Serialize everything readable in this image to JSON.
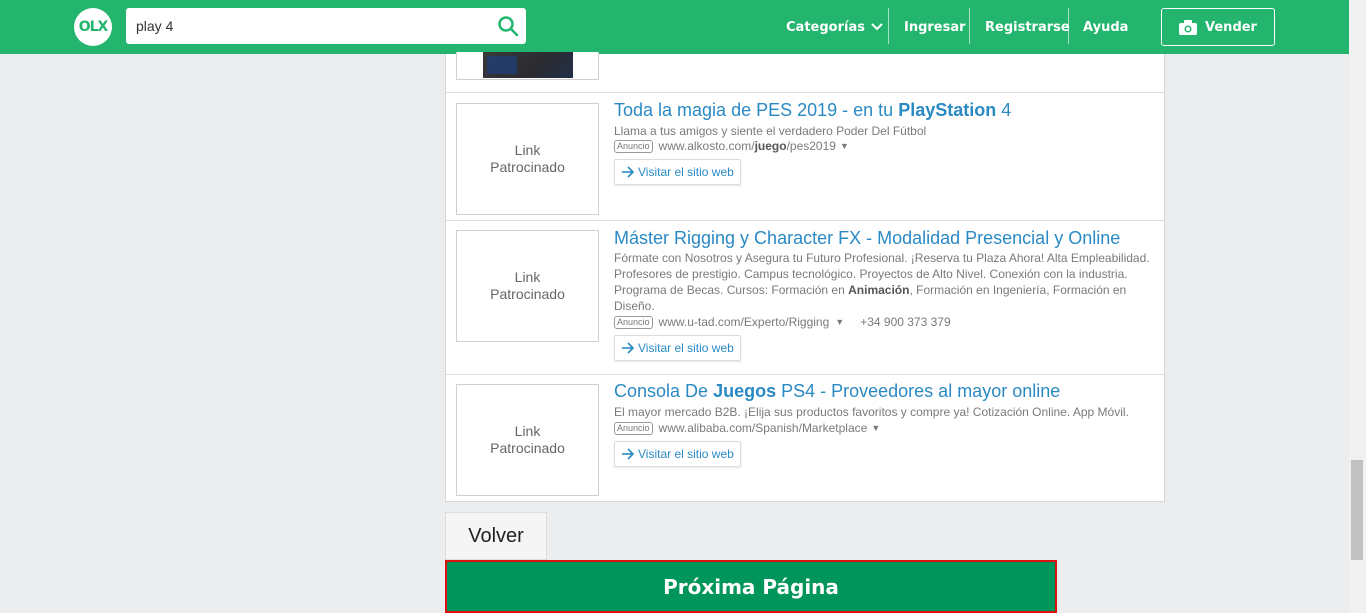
{
  "header": {
    "logo_text": "OLX",
    "search_value": "play 4",
    "nav": {
      "categorias": "Categorías",
      "ingresar": "Ingresar",
      "registrarse": "Registrarse",
      "ayuda": "Ayuda",
      "vender": "Vender"
    }
  },
  "ads": [
    {
      "thumb_label_1": "Link",
      "thumb_label_2": "Patrocinado",
      "title_pre": "Toda la magia de PES 2019 ",
      "title_dash": "- en tu ",
      "title_bold": "PlayStation",
      "title_post": " 4",
      "desc": "Llama a tus amigos y siente el verdadero Poder Del Fútbol",
      "badge": "Anuncio",
      "url_pre": "www.alkosto.com/",
      "url_bold": "juego",
      "url_post": "/pes2019",
      "visit": "Visitar el sitio web"
    },
    {
      "thumb_label_1": "Link",
      "thumb_label_2": "Patrocinado",
      "title_pre": "Máster Rigging y Character FX ",
      "title_dash": "- Modalidad Presencial y Online",
      "desc_pre": "Fórmate con Nosotros y Asegura tu Futuro Profesional. ¡Reserva tu Plaza Ahora! Alta Empleabilidad. Profesores de prestigio. Campus tecnológico. Proyectos de Alto Nivel. Conexión con la industria. Programa de Becas. Cursos: Formación en ",
      "desc_bold": "Animación",
      "desc_post": ", Formación en Ingeniería, Formación en Diseño.",
      "badge": "Anuncio",
      "url": "www.u-tad.com/Experto/Rigging",
      "phone": "+34 900 373 379",
      "visit": "Visitar el sitio web"
    },
    {
      "thumb_label_1": "Link",
      "thumb_label_2": "Patrocinado",
      "title_pre": "Consola De ",
      "title_bold": "Juegos",
      "title_mid": " PS4 ",
      "title_dash": "- Proveedores al mayor online",
      "desc": "El mayor mercado B2B. ¡Elija sus productos favoritos y compre ya! Cotización Online. App Móvil.",
      "badge": "Anuncio",
      "url": "www.alibaba.com/Spanish/Marketplace",
      "visit": "Visitar el sitio web"
    }
  ],
  "buttons": {
    "volver": "Volver",
    "next_page": "Próxima Página"
  },
  "colors": {
    "brand_green": "#23b56e",
    "next_button": "#00955a",
    "link_blue": "#2a8ac4",
    "highlight_border": "#dd1111"
  }
}
